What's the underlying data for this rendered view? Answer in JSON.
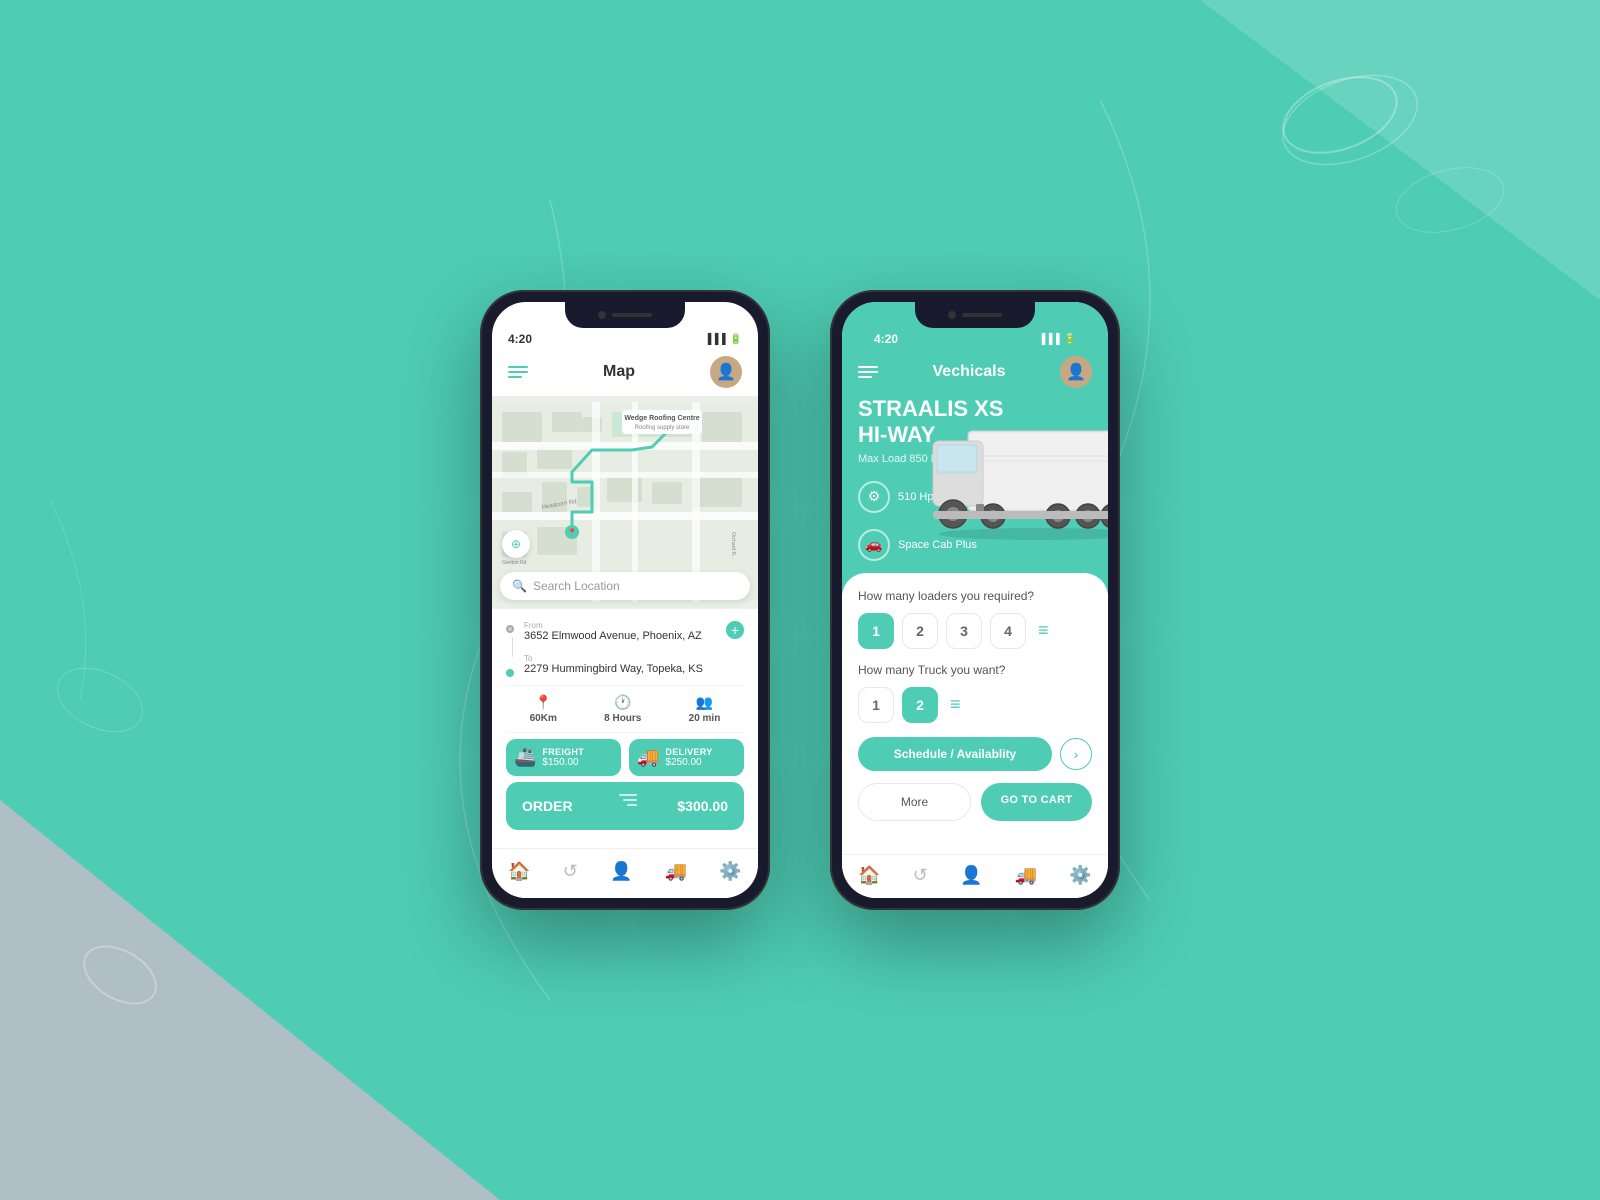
{
  "background": {
    "main_color": "#4ecdb4"
  },
  "phone1": {
    "status_time": "4:20",
    "header_title": "Map",
    "map_search_placeholder": "Search Location",
    "from_label": "From",
    "from_address": "3652 Elmwood Avenue, Phoenix, AZ",
    "to_label": "To",
    "to_address": "2279 Hummingbird Way, Topeka, KS",
    "stat1_value": "60Km",
    "stat2_value": "8 Hours",
    "stat3_value": "20 min",
    "freight_label": "FREIGHT",
    "freight_price": "$150.00",
    "delivery_label": "DELIVERY",
    "delivery_price": "$250.00",
    "order_label": "ORDER",
    "order_total": "$300.00"
  },
  "phone2": {
    "status_time": "4:20",
    "header_title": "Vechicals",
    "vehicle_name_line1": "STRAALIS XS",
    "vehicle_name_line2": "HI-WAY",
    "vehicle_subtitle": "Max Load 850 Kgs",
    "spec1": "510 Hp (375 kw)",
    "spec2": "Space Cab Plus",
    "loaders_question": "How many loaders you required?",
    "loaders_options": [
      "1",
      "2",
      "3",
      "4"
    ],
    "loaders_selected": 0,
    "truck_question": "How many Truck you want?",
    "truck_options": [
      "1",
      "2"
    ],
    "truck_selected": 1,
    "schedule_label": "Schedule / Availablity",
    "more_label": "More",
    "cart_label": "GO TO CART"
  }
}
